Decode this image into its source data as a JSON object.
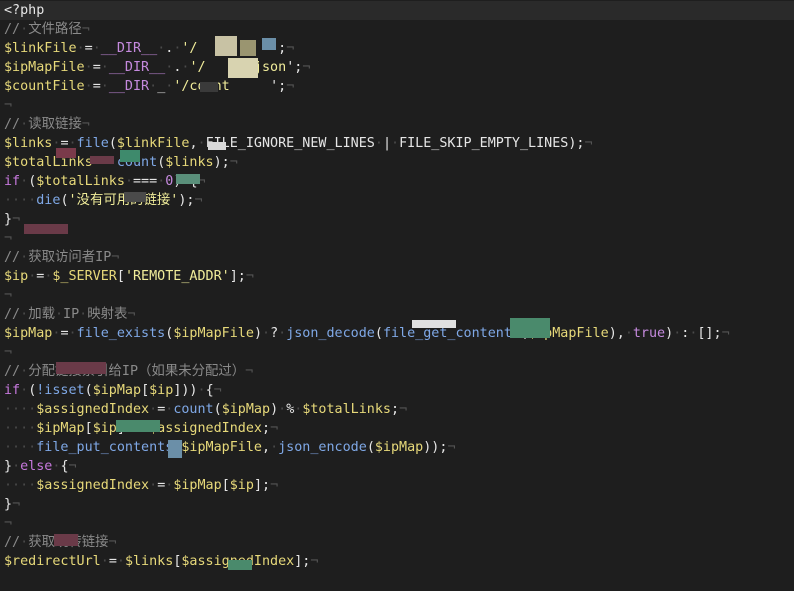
{
  "editor": {
    "language": "php",
    "colors": {
      "background": "#1e1e1e",
      "current_line": "#2a2a2a",
      "comment": "#8a8a8a",
      "variable": "#e7d97a",
      "function": "#7fa8e6",
      "string": "#f0ec9a",
      "keyword": "#c678dd",
      "constant": "#c58ade",
      "whitespace_marker": "#4a4a4a"
    },
    "lines": [
      {
        "tokens": [
          {
            "t": "<?php",
            "c": "text"
          }
        ],
        "current": true
      },
      {
        "tokens": [
          {
            "t": "//",
            "c": "comment"
          },
          {
            "t": "·",
            "c": "ws"
          },
          {
            "t": "文件路径",
            "c": "comment"
          },
          {
            "t": "¬",
            "c": "eol"
          }
        ]
      },
      {
        "tokens": [
          {
            "t": "$linkFile",
            "c": "var"
          },
          {
            "t": "·",
            "c": "ws"
          },
          {
            "t": "=",
            "c": "op"
          },
          {
            "t": "·",
            "c": "ws"
          },
          {
            "t": "__DIR__",
            "c": "const"
          },
          {
            "t": "·",
            "c": "ws"
          },
          {
            "t": ".",
            "c": "op"
          },
          {
            "t": "·",
            "c": "ws"
          },
          {
            "t": "'/     .   ",
            "c": "string"
          },
          {
            "t": "';",
            "c": "op"
          },
          {
            "t": "¬",
            "c": "eol"
          }
        ]
      },
      {
        "tokens": [
          {
            "t": "$ipMapFile",
            "c": "var"
          },
          {
            "t": "·",
            "c": "ws"
          },
          {
            "t": "=",
            "c": "op"
          },
          {
            "t": "·",
            "c": "ws"
          },
          {
            "t": "__DIR__",
            "c": "const"
          },
          {
            "t": "·",
            "c": "ws"
          },
          {
            "t": ".",
            "c": "op"
          },
          {
            "t": "·",
            "c": "ws"
          },
          {
            "t": "'/      json",
            "c": "string"
          },
          {
            "t": "';",
            "c": "op"
          },
          {
            "t": "¬",
            "c": "eol"
          }
        ]
      },
      {
        "tokens": [
          {
            "t": "$countFile",
            "c": "var"
          },
          {
            "t": "·",
            "c": "ws"
          },
          {
            "t": "=",
            "c": "op"
          },
          {
            "t": "·",
            "c": "ws"
          },
          {
            "t": "__DIR",
            "c": "const"
          },
          {
            "t": "·",
            "c": "ws"
          },
          {
            "t": "_",
            "c": "op"
          },
          {
            "t": "·",
            "c": "ws"
          },
          {
            "t": "'/count     ",
            "c": "string"
          },
          {
            "t": "';",
            "c": "op"
          },
          {
            "t": "¬",
            "c": "eol"
          }
        ]
      },
      {
        "tokens": [
          {
            "t": "¬",
            "c": "eol"
          }
        ]
      },
      {
        "tokens": [
          {
            "t": "//",
            "c": "comment"
          },
          {
            "t": "·",
            "c": "ws"
          },
          {
            "t": "读取链接",
            "c": "comment"
          },
          {
            "t": "¬",
            "c": "eol"
          }
        ]
      },
      {
        "tokens": [
          {
            "t": "$links",
            "c": "var"
          },
          {
            "t": "·",
            "c": "ws"
          },
          {
            "t": "=",
            "c": "op"
          },
          {
            "t": "·",
            "c": "ws"
          },
          {
            "t": "file",
            "c": "func"
          },
          {
            "t": "(",
            "c": "op"
          },
          {
            "t": "$linkFile",
            "c": "var"
          },
          {
            "t": ",",
            "c": "op"
          },
          {
            "t": "·",
            "c": "ws"
          },
          {
            "t": "FILE_IGNORE_NEW_LINES",
            "c": "text"
          },
          {
            "t": "·",
            "c": "ws"
          },
          {
            "t": "|",
            "c": "op"
          },
          {
            "t": "·",
            "c": "ws"
          },
          {
            "t": "FILE_SKIP_EMPTY_LINES",
            "c": "text"
          },
          {
            "t": ");",
            "c": "op"
          },
          {
            "t": "¬",
            "c": "eol"
          }
        ]
      },
      {
        "tokens": [
          {
            "t": "$totalLinks",
            "c": "var"
          },
          {
            "t": "·",
            "c": "ws"
          },
          {
            "t": "=",
            "c": "op"
          },
          {
            "t": "·",
            "c": "ws"
          },
          {
            "t": "count",
            "c": "func"
          },
          {
            "t": "(",
            "c": "op"
          },
          {
            "t": "$links",
            "c": "var"
          },
          {
            "t": ");",
            "c": "op"
          },
          {
            "t": "¬",
            "c": "eol"
          }
        ]
      },
      {
        "tokens": [
          {
            "t": "if",
            "c": "keyword"
          },
          {
            "t": "·",
            "c": "ws"
          },
          {
            "t": "(",
            "c": "op"
          },
          {
            "t": "$totalLinks",
            "c": "var"
          },
          {
            "t": "·",
            "c": "ws"
          },
          {
            "t": "===",
            "c": "op"
          },
          {
            "t": "·",
            "c": "ws"
          },
          {
            "t": "0",
            "c": "const"
          },
          {
            "t": ")",
            "c": "op"
          },
          {
            "t": "·",
            "c": "ws"
          },
          {
            "t": "{",
            "c": "op"
          },
          {
            "t": "¬",
            "c": "eol"
          }
        ]
      },
      {
        "tokens": [
          {
            "t": "····",
            "c": "ws"
          },
          {
            "t": "die",
            "c": "func"
          },
          {
            "t": "(",
            "c": "op"
          },
          {
            "t": "'没有可用的链接'",
            "c": "string"
          },
          {
            "t": ");",
            "c": "op"
          },
          {
            "t": "¬",
            "c": "eol"
          }
        ]
      },
      {
        "tokens": [
          {
            "t": "}",
            "c": "op"
          },
          {
            "t": "¬",
            "c": "eol"
          }
        ]
      },
      {
        "tokens": [
          {
            "t": "¬",
            "c": "eol"
          }
        ]
      },
      {
        "tokens": [
          {
            "t": "//",
            "c": "comment"
          },
          {
            "t": "·",
            "c": "ws"
          },
          {
            "t": "获取访问者IP",
            "c": "comment"
          },
          {
            "t": "¬",
            "c": "eol"
          }
        ]
      },
      {
        "tokens": [
          {
            "t": "$ip",
            "c": "var"
          },
          {
            "t": "·",
            "c": "ws"
          },
          {
            "t": "=",
            "c": "op"
          },
          {
            "t": "·",
            "c": "ws"
          },
          {
            "t": "$_SERVER",
            "c": "var"
          },
          {
            "t": "[",
            "c": "op"
          },
          {
            "t": "'REMOTE_ADDR'",
            "c": "string"
          },
          {
            "t": "];",
            "c": "op"
          },
          {
            "t": "¬",
            "c": "eol"
          }
        ]
      },
      {
        "tokens": [
          {
            "t": "¬",
            "c": "eol"
          }
        ]
      },
      {
        "tokens": [
          {
            "t": "//",
            "c": "comment"
          },
          {
            "t": "·",
            "c": "ws"
          },
          {
            "t": "加载",
            "c": "comment"
          },
          {
            "t": "·",
            "c": "ws"
          },
          {
            "t": "IP",
            "c": "comment"
          },
          {
            "t": "·",
            "c": "ws"
          },
          {
            "t": "映射表",
            "c": "comment"
          },
          {
            "t": "¬",
            "c": "eol"
          }
        ]
      },
      {
        "tokens": [
          {
            "t": "$ipMap",
            "c": "var"
          },
          {
            "t": "·",
            "c": "ws"
          },
          {
            "t": "=",
            "c": "op"
          },
          {
            "t": "·",
            "c": "ws"
          },
          {
            "t": "file_exists",
            "c": "func"
          },
          {
            "t": "(",
            "c": "op"
          },
          {
            "t": "$ipMapFile",
            "c": "var"
          },
          {
            "t": ")",
            "c": "op"
          },
          {
            "t": "·",
            "c": "ws"
          },
          {
            "t": "?",
            "c": "op"
          },
          {
            "t": "·",
            "c": "ws"
          },
          {
            "t": "json_decode",
            "c": "func"
          },
          {
            "t": "(",
            "c": "op"
          },
          {
            "t": "file_get_contents",
            "c": "func"
          },
          {
            "t": "(",
            "c": "op"
          },
          {
            "t": "$ipMapFile",
            "c": "var"
          },
          {
            "t": "),",
            "c": "op"
          },
          {
            "t": "·",
            "c": "ws"
          },
          {
            "t": "true",
            "c": "const"
          },
          {
            "t": ")",
            "c": "op"
          },
          {
            "t": "·",
            "c": "ws"
          },
          {
            "t": ":",
            "c": "op"
          },
          {
            "t": "·",
            "c": "ws"
          },
          {
            "t": "[];",
            "c": "op"
          },
          {
            "t": "¬",
            "c": "eol"
          }
        ]
      },
      {
        "tokens": [
          {
            "t": "¬",
            "c": "eol"
          }
        ]
      },
      {
        "tokens": [
          {
            "t": "//",
            "c": "comment"
          },
          {
            "t": "·",
            "c": "ws"
          },
          {
            "t": "分配链接索引给IP（如果未分配过）",
            "c": "comment"
          },
          {
            "t": "¬",
            "c": "eol"
          }
        ]
      },
      {
        "tokens": [
          {
            "t": "if",
            "c": "keyword"
          },
          {
            "t": "·",
            "c": "ws"
          },
          {
            "t": "(",
            "c": "op"
          },
          {
            "t": "!isset",
            "c": "func"
          },
          {
            "t": "(",
            "c": "op"
          },
          {
            "t": "$ipMap",
            "c": "var"
          },
          {
            "t": "[",
            "c": "op"
          },
          {
            "t": "$ip",
            "c": "var"
          },
          {
            "t": "]))",
            "c": "op"
          },
          {
            "t": "·",
            "c": "ws"
          },
          {
            "t": "{",
            "c": "op"
          },
          {
            "t": "¬",
            "c": "eol"
          }
        ]
      },
      {
        "tokens": [
          {
            "t": "····",
            "c": "ws"
          },
          {
            "t": "$assignedIndex",
            "c": "var"
          },
          {
            "t": "·",
            "c": "ws"
          },
          {
            "t": "=",
            "c": "op"
          },
          {
            "t": "·",
            "c": "ws"
          },
          {
            "t": "count",
            "c": "func"
          },
          {
            "t": "(",
            "c": "op"
          },
          {
            "t": "$ipMap",
            "c": "var"
          },
          {
            "t": ")",
            "c": "op"
          },
          {
            "t": "·",
            "c": "ws"
          },
          {
            "t": "%",
            "c": "op"
          },
          {
            "t": "·",
            "c": "ws"
          },
          {
            "t": "$totalLinks",
            "c": "var"
          },
          {
            "t": ";",
            "c": "op"
          },
          {
            "t": "¬",
            "c": "eol"
          }
        ]
      },
      {
        "tokens": [
          {
            "t": "····",
            "c": "ws"
          },
          {
            "t": "$ipMap",
            "c": "var"
          },
          {
            "t": "[",
            "c": "op"
          },
          {
            "t": "$ip",
            "c": "var"
          },
          {
            "t": "]",
            "c": "op"
          },
          {
            "t": "·",
            "c": "ws"
          },
          {
            "t": "=",
            "c": "op"
          },
          {
            "t": "·",
            "c": "ws"
          },
          {
            "t": "$assignedIndex",
            "c": "var"
          },
          {
            "t": ";",
            "c": "op"
          },
          {
            "t": "¬",
            "c": "eol"
          }
        ]
      },
      {
        "tokens": [
          {
            "t": "····",
            "c": "ws"
          },
          {
            "t": "file_put_contents",
            "c": "func"
          },
          {
            "t": "(",
            "c": "op"
          },
          {
            "t": "$ipMapFile",
            "c": "var"
          },
          {
            "t": ",",
            "c": "op"
          },
          {
            "t": "·",
            "c": "ws"
          },
          {
            "t": "json_encode",
            "c": "func"
          },
          {
            "t": "(",
            "c": "op"
          },
          {
            "t": "$ipMap",
            "c": "var"
          },
          {
            "t": "));",
            "c": "op"
          },
          {
            "t": "¬",
            "c": "eol"
          }
        ]
      },
      {
        "tokens": [
          {
            "t": "}",
            "c": "op"
          },
          {
            "t": "·",
            "c": "ws"
          },
          {
            "t": "else",
            "c": "keyword"
          },
          {
            "t": "·",
            "c": "ws"
          },
          {
            "t": "{",
            "c": "op"
          },
          {
            "t": "¬",
            "c": "eol"
          }
        ]
      },
      {
        "tokens": [
          {
            "t": "····",
            "c": "ws"
          },
          {
            "t": "$assignedIndex",
            "c": "var"
          },
          {
            "t": "·",
            "c": "ws"
          },
          {
            "t": "=",
            "c": "op"
          },
          {
            "t": "·",
            "c": "ws"
          },
          {
            "t": "$ipMap",
            "c": "var"
          },
          {
            "t": "[",
            "c": "op"
          },
          {
            "t": "$ip",
            "c": "var"
          },
          {
            "t": "];",
            "c": "op"
          },
          {
            "t": "¬",
            "c": "eol"
          }
        ]
      },
      {
        "tokens": [
          {
            "t": "}",
            "c": "op"
          },
          {
            "t": "¬",
            "c": "eol"
          }
        ]
      },
      {
        "tokens": [
          {
            "t": "¬",
            "c": "eol"
          }
        ]
      },
      {
        "tokens": [
          {
            "t": "//",
            "c": "comment"
          },
          {
            "t": "·",
            "c": "ws"
          },
          {
            "t": "获取跳转链接",
            "c": "comment"
          },
          {
            "t": "¬",
            "c": "eol"
          }
        ]
      },
      {
        "tokens": [
          {
            "t": "$redirectUrl",
            "c": "var"
          },
          {
            "t": "·",
            "c": "ws"
          },
          {
            "t": "=",
            "c": "op"
          },
          {
            "t": "·",
            "c": "ws"
          },
          {
            "t": "$links",
            "c": "var"
          },
          {
            "t": "[",
            "c": "op"
          },
          {
            "t": "$assignedIndex",
            "c": "var"
          },
          {
            "t": "];",
            "c": "op"
          },
          {
            "t": "¬",
            "c": "eol"
          }
        ]
      }
    ]
  }
}
